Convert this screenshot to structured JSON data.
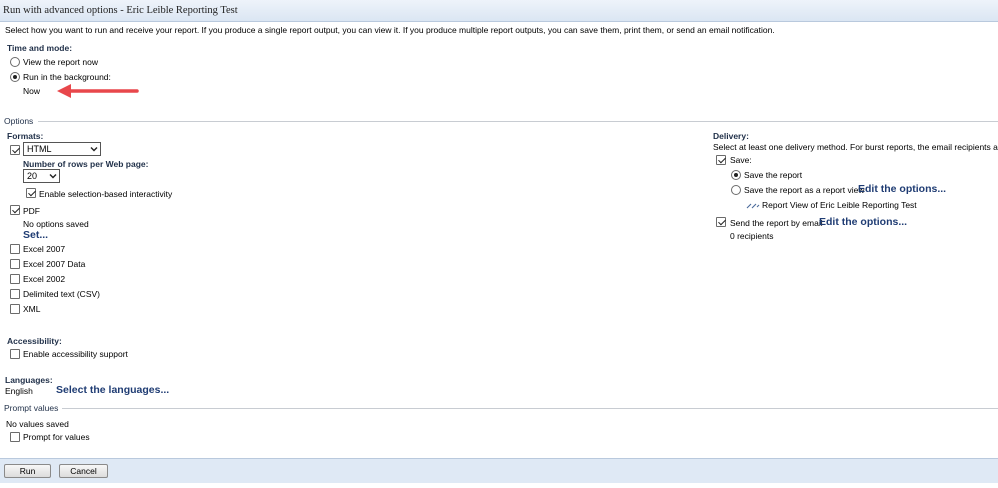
{
  "title": "Run with advanced options - Eric Leible Reporting Test",
  "intro": "Select how you want to run and receive your report. If you produce a single report output, you can view it. If you produce multiple report outputs, you can save them, print them, or send an email notification.",
  "time_mode": {
    "heading": "Time and mode:",
    "view_now": "View the report now",
    "run_background": "Run in the background:",
    "now": "Now"
  },
  "options": {
    "heading": "Options",
    "formats_heading": "Formats:",
    "html_format": "HTML",
    "rows_label": "Number of rows per Web page:",
    "rows_value": "20",
    "enable_interactivity": "Enable selection-based interactivity",
    "pdf": "PDF",
    "pdf_status": "No options saved",
    "pdf_set_link": "Set...",
    "excel2007": "Excel 2007",
    "excel2007data": "Excel 2007 Data",
    "excel2002": "Excel 2002",
    "csv": "Delimited text (CSV)",
    "xml": "XML"
  },
  "accessibility": {
    "heading": "Accessibility:",
    "enable": "Enable accessibility support"
  },
  "languages": {
    "heading": "Languages:",
    "value": "English",
    "link": "Select the languages..."
  },
  "prompt": {
    "heading": "Prompt values",
    "status": "No values saved",
    "checkbox": "Prompt for values"
  },
  "delivery": {
    "heading": "Delivery:",
    "description": "Select at least one delivery method. For burst reports, the email recipients are determ",
    "save": "Save:",
    "save_report": "Save the report",
    "save_as_view": "Save the report as a report view",
    "edit_options_1": "Edit the options...",
    "report_view_name": "Report View of Eric Leible Reporting Test",
    "send_email": "Send the report by email",
    "edit_options_2": "Edit the options...",
    "recipients": "0 recipients"
  },
  "buttons": {
    "run": "Run",
    "cancel": "Cancel"
  },
  "icons": {
    "chevron": "chevron-down-icon",
    "report_view": "report-view-icon",
    "annotation": "red-arrow-annotation"
  },
  "colors": {
    "accent_link": "#1f3c73",
    "annotation_arrow": "#e8474b",
    "footer_bg": "#dfe9f5"
  }
}
